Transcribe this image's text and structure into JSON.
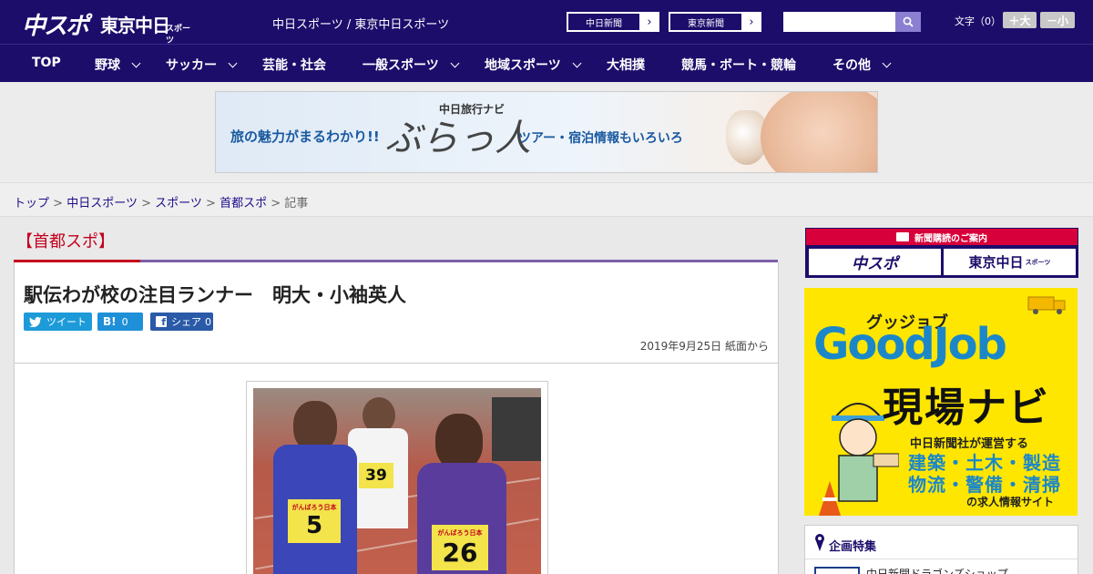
{
  "header": {
    "logo_primary": "中スポ",
    "logo_secondary": "東京中日",
    "logo_secondary_small": "スポーツ",
    "site_title": "中日スポーツ / 東京中日スポーツ",
    "paper_links": [
      {
        "label": "中日新聞"
      },
      {
        "label": "東京新聞"
      }
    ],
    "search_placeholder": "",
    "font_size_label": "文字（0）",
    "font_larger": "＋大",
    "font_smaller": "－小"
  },
  "nav": {
    "items": [
      {
        "label": "TOP",
        "has_dropdown": false
      },
      {
        "label": "野球",
        "has_dropdown": true
      },
      {
        "label": "サッカー",
        "has_dropdown": true
      },
      {
        "label": "芸能・社会",
        "has_dropdown": false
      },
      {
        "label": "一般スポーツ",
        "has_dropdown": true
      },
      {
        "label": "地域スポーツ",
        "has_dropdown": true
      },
      {
        "label": "大相撲",
        "has_dropdown": false
      },
      {
        "label": "競馬・ボート・競輪",
        "has_dropdown": false
      },
      {
        "label": "その他",
        "has_dropdown": true
      }
    ]
  },
  "banner": {
    "lead": "旅の魅力がまるわかり!!",
    "sub": "中日旅行ナビ",
    "main": "ぶらっ人",
    "tail": "ツアー・宿泊情報もいろいろ"
  },
  "breadcrumb": {
    "items": [
      "トップ",
      "中日スポーツ",
      "スポーツ",
      "首都スポ"
    ],
    "current": "記事",
    "separator": ">"
  },
  "article": {
    "section": "【首都スポ】",
    "headline": "駅伝わが校の注目ランナー　明大・小袖英人",
    "share": {
      "tweet_label": "ツイート",
      "hatena_label": "B!",
      "hatena_count": "0",
      "facebook_label": "シェア",
      "facebook_count": "0"
    },
    "date": "2019年9月25日 紙面から",
    "photo": {
      "bibs": [
        "5",
        "26",
        "39"
      ],
      "bib_banner": "がんばろう日本"
    }
  },
  "sidebar": {
    "subscription": {
      "heading": "新聞購読のご案内",
      "left": "中スポ",
      "right": "東京中日",
      "right_small": "スポーツ"
    },
    "goodjob": {
      "kana": "グッジョブ",
      "title": "GoodJob",
      "navi": "現場ナビ",
      "sub": "中日新聞社が運営する",
      "line1": "建築・土木・製造",
      "line2": "物流・警備・清掃",
      "foot": "の求人情報サイト"
    },
    "feature": {
      "title": "企画特集",
      "item": "中日新聞ドラゴンズショップ"
    }
  },
  "colors": {
    "brand_navy": "#1c0d6b",
    "accent_red": "#c4001d",
    "accent_purple": "#7b5fa8",
    "twitter": "#1d9bd9",
    "facebook": "#2a5aa8",
    "goodjob_yellow": "#ffe600",
    "goodjob_blue": "#1b87c9"
  }
}
